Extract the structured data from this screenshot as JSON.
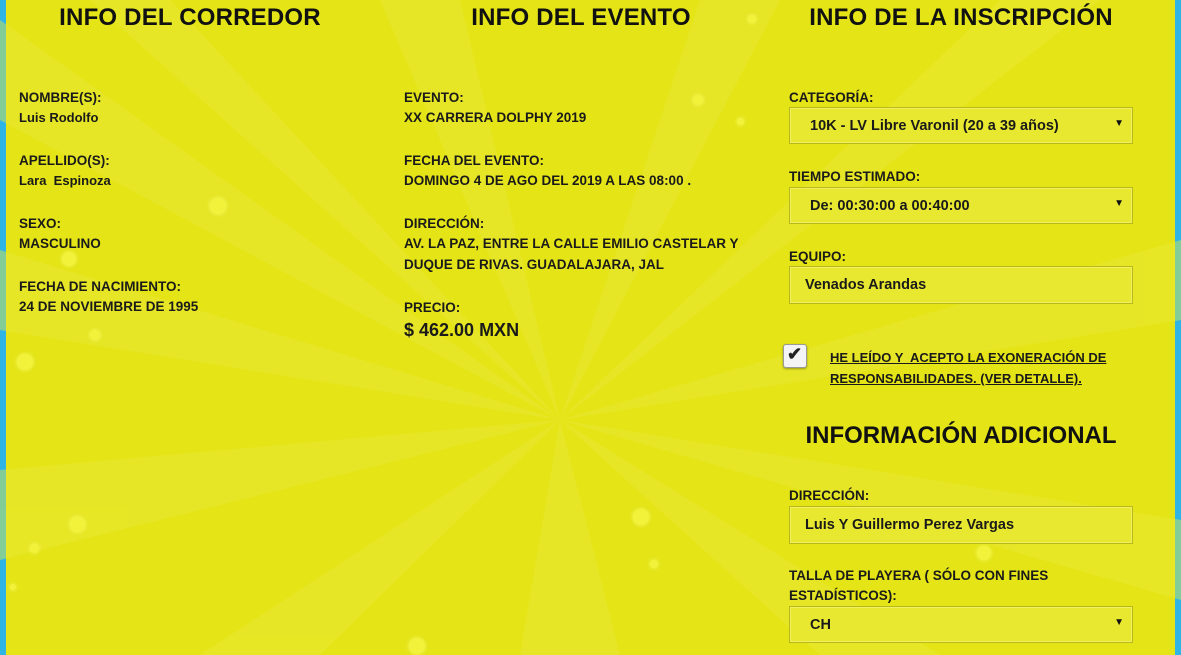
{
  "runner": {
    "title": "INFO DEL CORREDOR",
    "name_label": "NOMBRE(S):",
    "name_value": "Luis Rodolfo",
    "surname_label": "APELLIDO(S):",
    "surname_value": "Lara  Espinoza",
    "sex_label": "SEXO:",
    "sex_value": "MASCULINO",
    "birth_label": "FECHA DE NACIMIENTO:",
    "birth_value": "24 DE NOVIEMBRE DE 1995"
  },
  "event": {
    "title": "INFO DEL EVENTO",
    "event_label": "EVENTO:",
    "event_value": "XX CARRERA DOLPHY 2019",
    "date_label": "FECHA DEL EVENTO:",
    "date_value": "DOMINGO 4 DE AGO DEL 2019 A LAS 08:00 .",
    "address_label": "DIRECCIÓN:",
    "address_line1": "AV. LA PAZ, ENTRE LA CALLE EMILIO CASTELAR Y",
    "address_line2": "DUQUE DE RIVAS. GUADALAJARA, JAL",
    "price_label": "PRECIO:",
    "price_value": "$ 462.00 MXN"
  },
  "registration": {
    "title": "INFO DE LA INSCRIPCIÓN",
    "category_label": "CATEGORÍA:",
    "category_value": "10K - LV Libre Varonil (20 a 39 años)",
    "time_label": "TIEMPO ESTIMADO:",
    "time_value": "De: 00:30:00 a 00:40:00",
    "team_label": "EQUIPO:",
    "team_value": "Venados Arandas",
    "terms_checked": true,
    "terms_line1": "HE LEÍDO Y  ACEPTO LA EXONERACIÓN DE",
    "terms_line2": "RESPONSABILIDADES. (VER DETALLE)."
  },
  "additional": {
    "title": "INFORMACIÓN ADICIONAL",
    "address_label": "DIRECCIÓN:",
    "address_value": "Luis Y Guillermo Perez Vargas",
    "shirt_label_line1": "TALLA DE PLAYERA ( SÓLO CON FINES",
    "shirt_label_line2": "ESTADÍSTICOS):",
    "shirt_value": "CH"
  },
  "colors": {
    "background": "#e4e417",
    "edge": "#2fb4e6",
    "text": "#1a1a1a"
  },
  "icons": {
    "select_caret": "caret-down-icon",
    "checkbox": "checkmark-icon"
  }
}
